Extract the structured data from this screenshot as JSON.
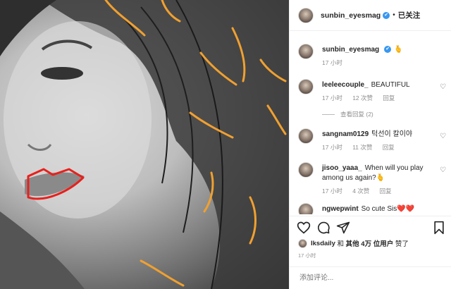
{
  "header": {
    "username": "sunbin_eyesmag",
    "verified_mark": "✔",
    "separator": "•",
    "follow_label": "已关注"
  },
  "caption": {
    "username": "sunbin_eyesmag",
    "text": "🫰",
    "time": "17 小时"
  },
  "comments": [
    {
      "username": "leeleecouple_",
      "text": "BEAUTIFUL",
      "time": "17 小时",
      "likes": "12 次赞",
      "reply": "回复"
    },
    {
      "username": "sangnam0129",
      "text": "턱선이 칼이야",
      "time": "17 小时",
      "likes": "11 次赞",
      "reply": "回复"
    },
    {
      "username": "jisoo_yaaa_",
      "text": "When will you play among us again?🫰",
      "time": "17 小时",
      "likes": "4 次赞",
      "reply": "回复"
    },
    {
      "username": "ngwepwint",
      "text": "So cute Sis❤️❤️"
    }
  ],
  "view_replies": "查看回复 (2)",
  "likes": {
    "user": "lksdaily",
    "middle": " 和 ",
    "count": "其他 4万 位用户",
    "end": " 赞了"
  },
  "post_time": "17 小时",
  "add_comment_placeholder": "添加评论...",
  "icons": {
    "heart": "heart-icon",
    "comment": "comment-icon",
    "share": "share-icon",
    "save": "bookmark-icon"
  },
  "colors": {
    "verified": "#3897f0",
    "doodle_orange": "#f0a030",
    "doodle_red": "#e8201c"
  }
}
